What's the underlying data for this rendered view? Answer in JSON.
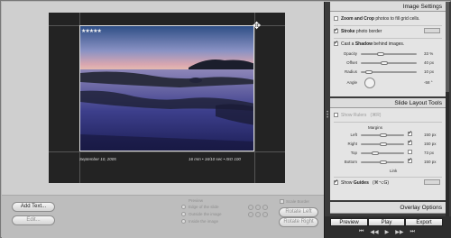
{
  "slide": {
    "caption_left": "September 10, 2005",
    "caption_right": "16 mm • 16/10 sec • ISO 100",
    "rating": "★★★★★"
  },
  "toolstrip": {
    "add_text": "Add Text...",
    "edit": "Edit...",
    "preview_label": "Preview",
    "options": [
      "Edge of the slide",
      "Outside the image",
      "Inside the image"
    ],
    "scale_label": "Scale Border",
    "rotate_left": "Rotate Left",
    "rotate_right": "Rotate Right"
  },
  "panel": {
    "image_settings": {
      "title": "Image Settings",
      "zoom_bold": "Zoom and Crop",
      "zoom_rest": "photos to fill grid cells.",
      "stroke_bold": "Stroke",
      "stroke_rest": "photo border",
      "shadow_pre": "Cast a",
      "shadow_bold": "Shadow",
      "shadow_rest": "behind images.",
      "sliders": [
        {
          "label": "Opacity",
          "value": "33 %",
          "level": 0.33
        },
        {
          "label": "Offset",
          "value": "40 px",
          "level": 0.4
        },
        {
          "label": "Radius",
          "value": "10 px",
          "level": 0.1
        },
        {
          "label": "Angle",
          "value": "-58 °"
        }
      ]
    },
    "layout_tools": {
      "title": "Slide Layout Tools",
      "show_rulers": "Show Rulers",
      "rulers_shortcut": "(⌘R)",
      "margins_label": "Margins",
      "margins": [
        {
          "label": "Left",
          "value": "150 px",
          "level": 0.52
        },
        {
          "label": "Right",
          "value": "150 px",
          "level": 0.52
        },
        {
          "label": "Top",
          "value": "73 px",
          "level": 0.3
        },
        {
          "label": "Bottom",
          "value": "150 px",
          "level": 0.52
        }
      ],
      "link_label": "Link",
      "show_guides_pre": "Show",
      "show_guides_bold": "Guides",
      "guides_shortcut": "(⌘⌥G)"
    },
    "overlay": {
      "title": "Overlay Options"
    },
    "buttons": {
      "preview": "Preview",
      "play": "Play",
      "export": "Export"
    },
    "transport": [
      "⏮",
      "◀◀",
      "▶",
      "▶▶",
      "⏭"
    ]
  }
}
